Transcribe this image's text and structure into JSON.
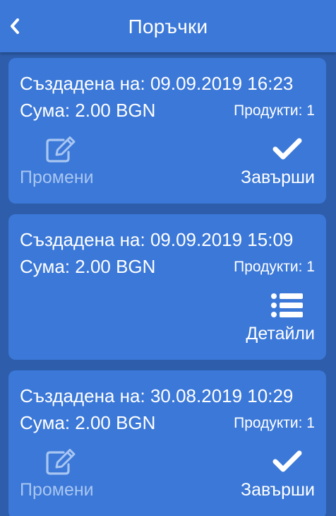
{
  "header": {
    "title": "Поръчки",
    "back_icon": "chevron-left-icon"
  },
  "orders": [
    {
      "created": "Създадена на: 09.09.2019 16:23",
      "sum": "Сума: 2.00 BGN",
      "products": "Продукти: 1",
      "edit_label": "Промени",
      "action_label": "Завърши",
      "action_icon": "check-icon"
    },
    {
      "created": "Създадена на: 09.09.2019 15:09",
      "sum": "Сума: 2.00 BGN",
      "products": "Продукти: 1",
      "action_label": "Детайли",
      "action_icon": "list-icon"
    },
    {
      "created": "Създадена на: 30.08.2019 10:29",
      "sum": "Сума: 2.00 BGN",
      "products": "Продукти: 1",
      "edit_label": "Промени",
      "action_label": "Завърши",
      "action_icon": "check-icon"
    }
  ],
  "colors": {
    "background": "#2e5dab",
    "header": "#3b78d8",
    "card": "#3b78d8",
    "muted_text": "#a9c6f1",
    "text": "#ffffff"
  }
}
